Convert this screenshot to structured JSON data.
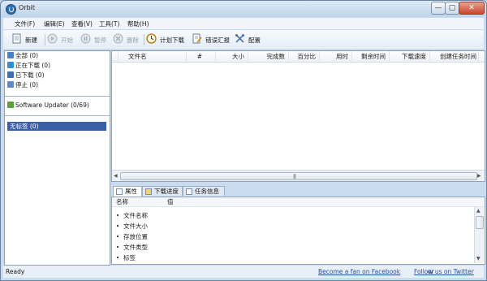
{
  "window": {
    "title": "Orbit",
    "min_glyph": "—",
    "max_glyph": "▢",
    "close_glyph": "✕"
  },
  "menu": [
    "文件(F)",
    "编辑(E)",
    "查看(V)",
    "工具(T)",
    "帮助(H)"
  ],
  "toolbar": {
    "new_label": "新建",
    "start_label": "开始",
    "pause_label": "暂停",
    "delete_label": "删除",
    "schedule_label": "计划下载",
    "report_label": "错误汇报",
    "config_label": "配置"
  },
  "sidebar": {
    "categories": [
      {
        "label": "全部 (0)"
      },
      {
        "label": "正在下载 (0)"
      },
      {
        "label": "已下载 (0)"
      },
      {
        "label": "停止 (0)"
      }
    ],
    "updater": "Software Updater (0/69)",
    "tag": "无标签 (0)"
  },
  "list": {
    "columns": [
      "文件名",
      "#",
      "大小",
      "完成数",
      "百分比",
      "用时",
      "剩余时间",
      "下载速度",
      "创建任务时间"
    ]
  },
  "tabs": [
    "属性",
    "下载进度",
    "任务信息"
  ],
  "properties": {
    "col_name": "名称",
    "col_value": "值",
    "rows": [
      "文件名称",
      "文件大小",
      "存放位置",
      "文件类型",
      "标签"
    ]
  },
  "status": {
    "text": "Ready",
    "facebook_link": "Become a fan on Facebook",
    "or_text": "or",
    "twitter_link": "Follow us on Twitter"
  },
  "colors": {
    "selected_bg": "#3a5fa8",
    "link": "#1d4fa3",
    "close_button": "#c8452c"
  },
  "icons": [
    "orbit-logo-icon",
    "new-icon",
    "play-icon",
    "pause-icon",
    "delete-icon",
    "clock-icon",
    "report-icon",
    "config-icon",
    "all-icon",
    "downloading-icon",
    "downloaded-icon",
    "stopped-icon",
    "updater-icon",
    "properties-icon",
    "progress-icon",
    "info-icon"
  ]
}
